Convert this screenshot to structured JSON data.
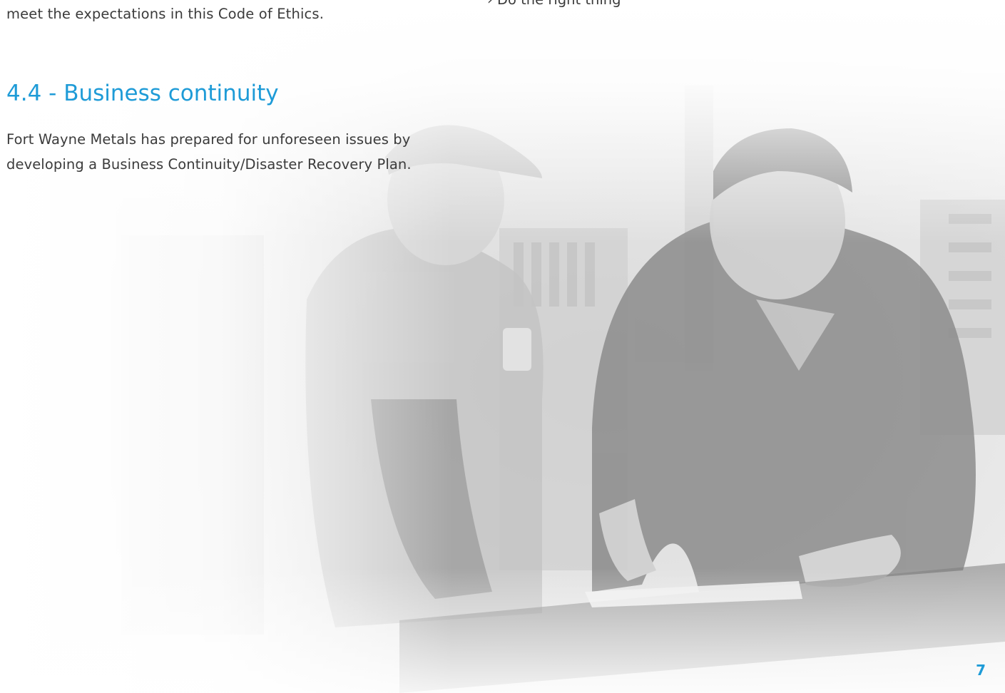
{
  "page": {
    "intro_tail": "meet the expectations in this Code of Ethics.",
    "bullet_tail": "› Do the right thing",
    "section_heading": "4.4 - Business continuity",
    "section_body": "Fort Wayne Metals has prepared for unforeseen issues by developing a Business Continuity/Disaster Recovery Plan.",
    "page_number": "7"
  },
  "colors": {
    "accent": "#1e9bd7",
    "body_text": "#3b3b3b"
  }
}
